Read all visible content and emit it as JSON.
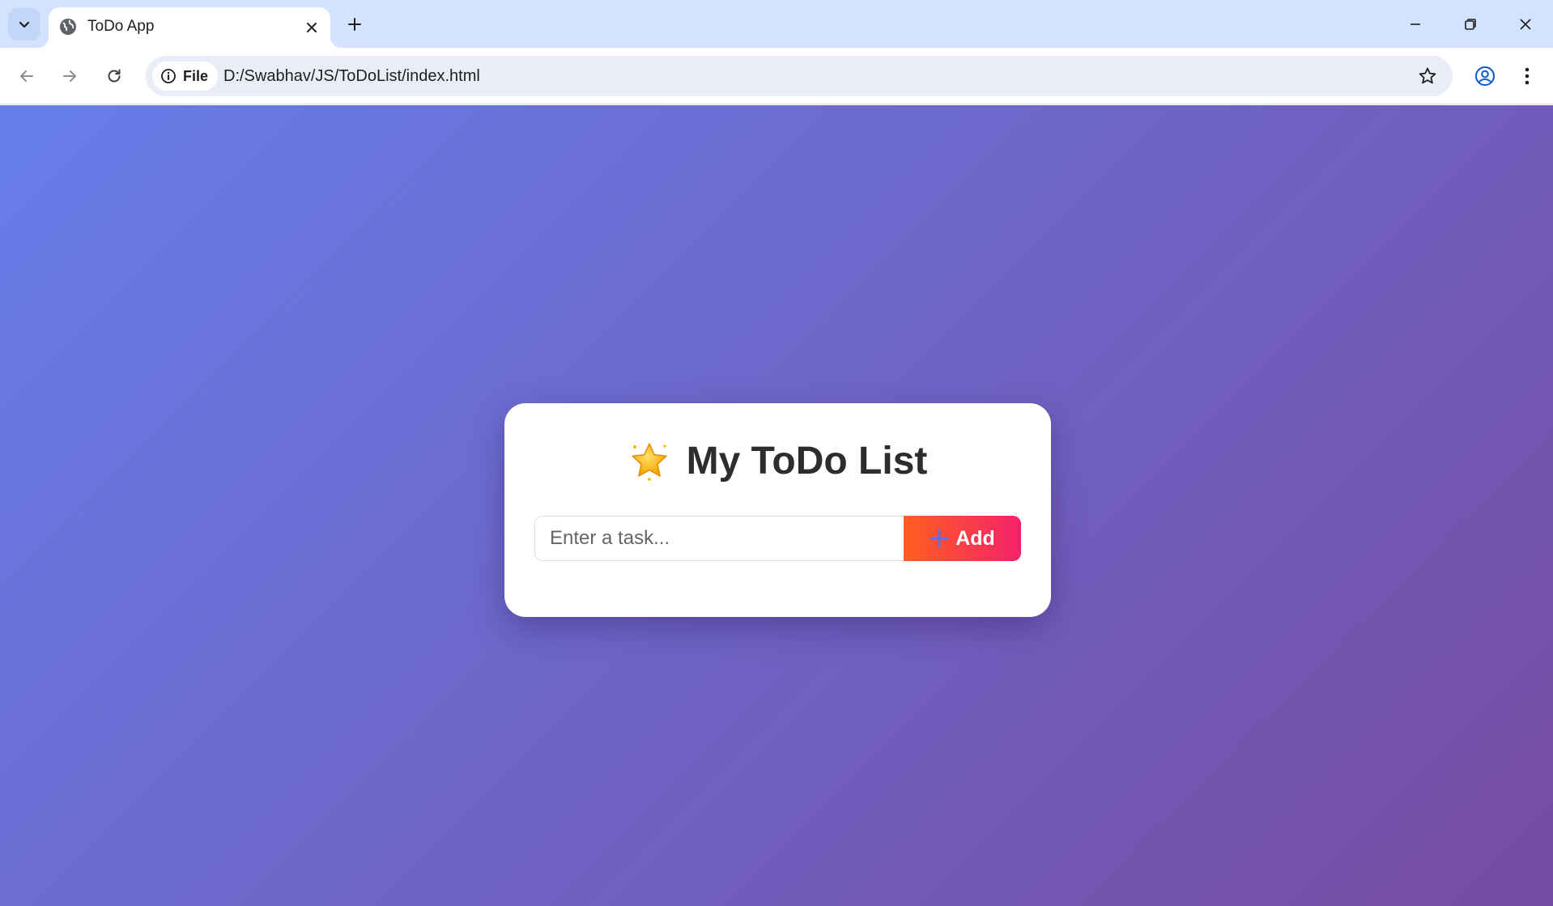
{
  "browser": {
    "tab": {
      "title": "ToDo App",
      "favicon": "globe-icon"
    },
    "address": {
      "chip_label": "File",
      "url": "D:/Swabhav/JS/ToDoList/index.html"
    },
    "icons": [
      "chevron-down-icon",
      "close-icon",
      "plus-icon",
      "minimize-icon",
      "restore-icon",
      "back-arrow-icon",
      "forward-arrow-icon",
      "reload-icon",
      "info-icon",
      "star-icon",
      "profile-icon",
      "more-vert-icon"
    ]
  },
  "page": {
    "background_gradient": [
      "#667eea",
      "#764ba2"
    ],
    "title": "My ToDo List",
    "title_icon": "star-emoji-icon",
    "input": {
      "placeholder": "Enter a task...",
      "value": ""
    },
    "add_button": {
      "label": "Add",
      "icon": "plus-icon",
      "gradient": [
        "#ff5f1f",
        "#f5226b"
      ]
    }
  }
}
